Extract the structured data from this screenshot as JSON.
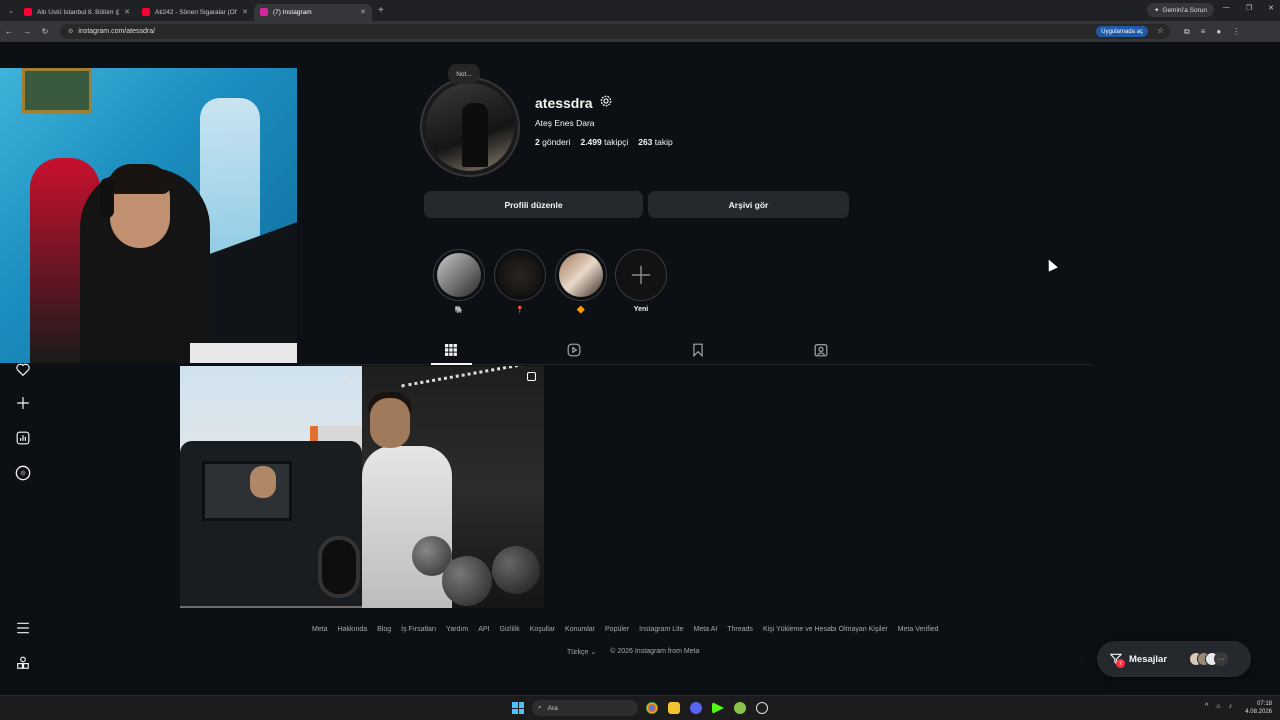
{
  "browser": {
    "tabs": [
      {
        "title": "Altı Üstü İstanbul 8. Bölüm @ar",
        "favicon_color": "#ff0033",
        "active": false
      },
      {
        "title": "Ati242 - Sönen Sigaralar (Of",
        "favicon_color": "#ff0033",
        "active": false
      },
      {
        "title": "(7) Instagram",
        "favicon_color": "#d6249f",
        "active": true
      }
    ],
    "gemini_label": "Gemini'a Sorun",
    "url": "instagram.com/atessdra/",
    "open_in_app": "Uygulamada aç"
  },
  "profile": {
    "note_label": "Not...",
    "username": "atessdra",
    "full_name": "Ateş Enes Dara",
    "stats": {
      "posts_count": "2",
      "posts_label": "gönderi",
      "followers_count": "2.499",
      "followers_label": "takipçi",
      "following_count": "263",
      "following_label": "takip"
    },
    "edit_button": "Profili düzenle",
    "archive_button": "Arşivi gör"
  },
  "highlights": [
    {
      "label": "🐘",
      "color": "#7a7a7a"
    },
    {
      "label": "📍",
      "color": "#1a1a1a"
    },
    {
      "label": "🔶",
      "color": "#8a6a50"
    },
    {
      "label": "Yeni",
      "color": "#0c1014"
    }
  ],
  "footer": {
    "links": [
      "Meta",
      "Hakkında",
      "Blog",
      "İş Fırsatları",
      "Yardım",
      "API",
      "Gizlilik",
      "Koşullar",
      "Konumlar",
      "Popüler",
      "Instagram Lite",
      "Meta AI",
      "Threads",
      "Kişi Yükleme ve Hesabı Olmayan Kişiler",
      "Meta Verified"
    ],
    "language": "Türkçe",
    "copyright": "© 2026 Instagram from Meta"
  },
  "messages": {
    "label": "Mesajlar",
    "badge": "7"
  },
  "taskbar": {
    "search_placeholder": "Ara",
    "time": "07:18",
    "date": "4.08.2026"
  },
  "colors": {
    "background": "#0c1014",
    "button_bg": "#25292e",
    "accent_badge": "#ff3040"
  }
}
